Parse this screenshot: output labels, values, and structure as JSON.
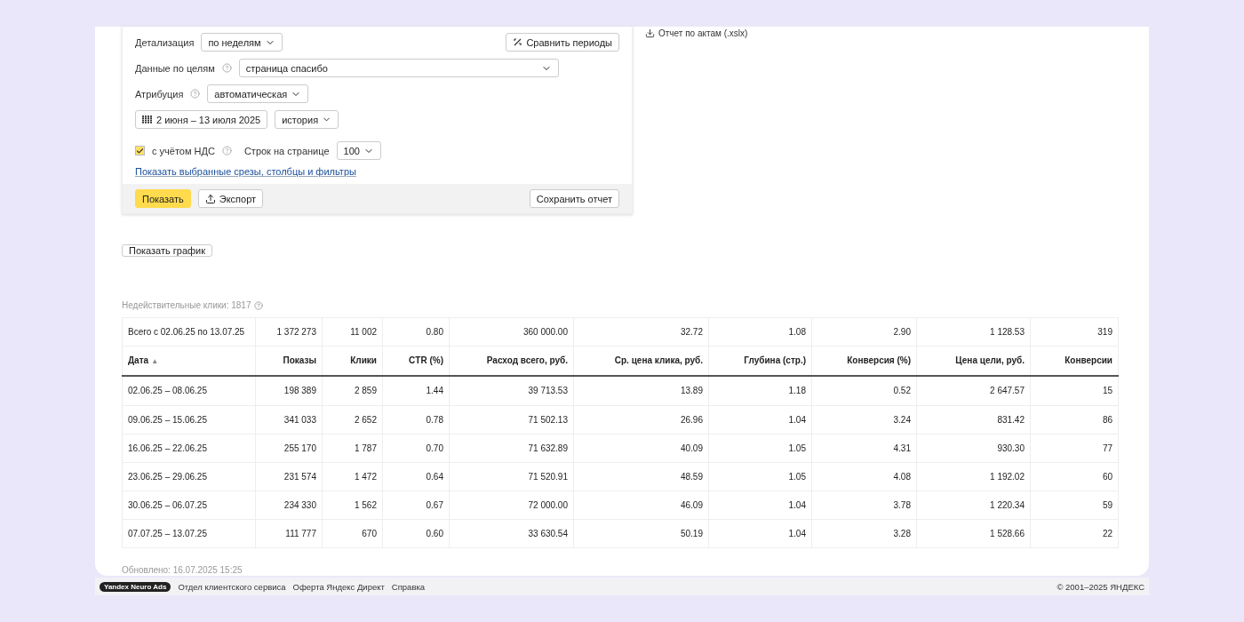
{
  "filters": {
    "detail": {
      "label": "Детализация",
      "value": "по неделям"
    },
    "compare_button": "Сравнить периоды",
    "goals": {
      "label": "Данные по целям",
      "value": "страница спасибо"
    },
    "attribution": {
      "label": "Атрибуция",
      "value": "автоматическая"
    },
    "date_range": "2 июня – 13 июля 2025",
    "history": "история",
    "vat": {
      "label": "с учётом НДС",
      "checked": true
    },
    "rows_per_page": {
      "label": "Строк на странице",
      "value": "100"
    },
    "link": "Показать выбранные срезы, столбцы и фильтры",
    "buttons": {
      "show": "Показать",
      "export": "Экспорт",
      "save": "Сохранить отчет"
    }
  },
  "acts_report": "Отчет по актам (.xslx)",
  "show_chart": "Показать график",
  "invalid_clicks": "Недействительные клики: 1817",
  "table": {
    "columns": [
      {
        "label": "Дата",
        "sort": "▲"
      },
      {
        "label": "Показы"
      },
      {
        "label": "Клики"
      },
      {
        "label": "CTR (%)"
      },
      {
        "label": "Расход всего, руб."
      },
      {
        "label": "Ср. цена клика, руб."
      },
      {
        "label": "Глубина (стр.)"
      },
      {
        "label": "Конверсия (%)"
      },
      {
        "label": "Цена цели, руб."
      },
      {
        "label": "Конверсии"
      }
    ],
    "total": [
      "Всего с 02.06.25 по 13.07.25",
      "1 372 273",
      "11 002",
      "0.80",
      "360 000.00",
      "32.72",
      "1.08",
      "2.90",
      "1 128.53",
      "319"
    ],
    "rows": [
      [
        "02.06.25 – 08.06.25",
        "198 389",
        "2 859",
        "1.44",
        "39 713.53",
        "13.89",
        "1.18",
        "0.52",
        "2 647.57",
        "15"
      ],
      [
        "09.06.25 – 15.06.25",
        "341 033",
        "2 652",
        "0.78",
        "71 502.13",
        "26.96",
        "1.04",
        "3.24",
        "831.42",
        "86"
      ],
      [
        "16.06.25 – 22.06.25",
        "255 170",
        "1 787",
        "0.70",
        "71 632.89",
        "40.09",
        "1.05",
        "4.31",
        "930.30",
        "77"
      ],
      [
        "23.06.25 – 29.06.25",
        "231 574",
        "1 472",
        "0.64",
        "71 520.91",
        "48.59",
        "1.05",
        "4.08",
        "1 192.02",
        "60"
      ],
      [
        "30.06.25 – 06.07.25",
        "234 330",
        "1 562",
        "0.67",
        "72 000.00",
        "46.09",
        "1.04",
        "3.78",
        "1 220.34",
        "59"
      ],
      [
        "07.07.25 – 13.07.25",
        "111 777",
        "670",
        "0.60",
        "33 630.54",
        "50.19",
        "1.04",
        "3.28",
        "1 528.66",
        "22"
      ]
    ]
  },
  "updated": "Обновлено: 16.07.2025 15:25",
  "footer": {
    "logo": "Yandex Neuro Ads",
    "links": [
      "Отдел клиентского сервиса",
      "Оферта Яндекс Директ",
      "Справка"
    ],
    "copyright": "© 2001–2025 ЯНДЕКС"
  }
}
